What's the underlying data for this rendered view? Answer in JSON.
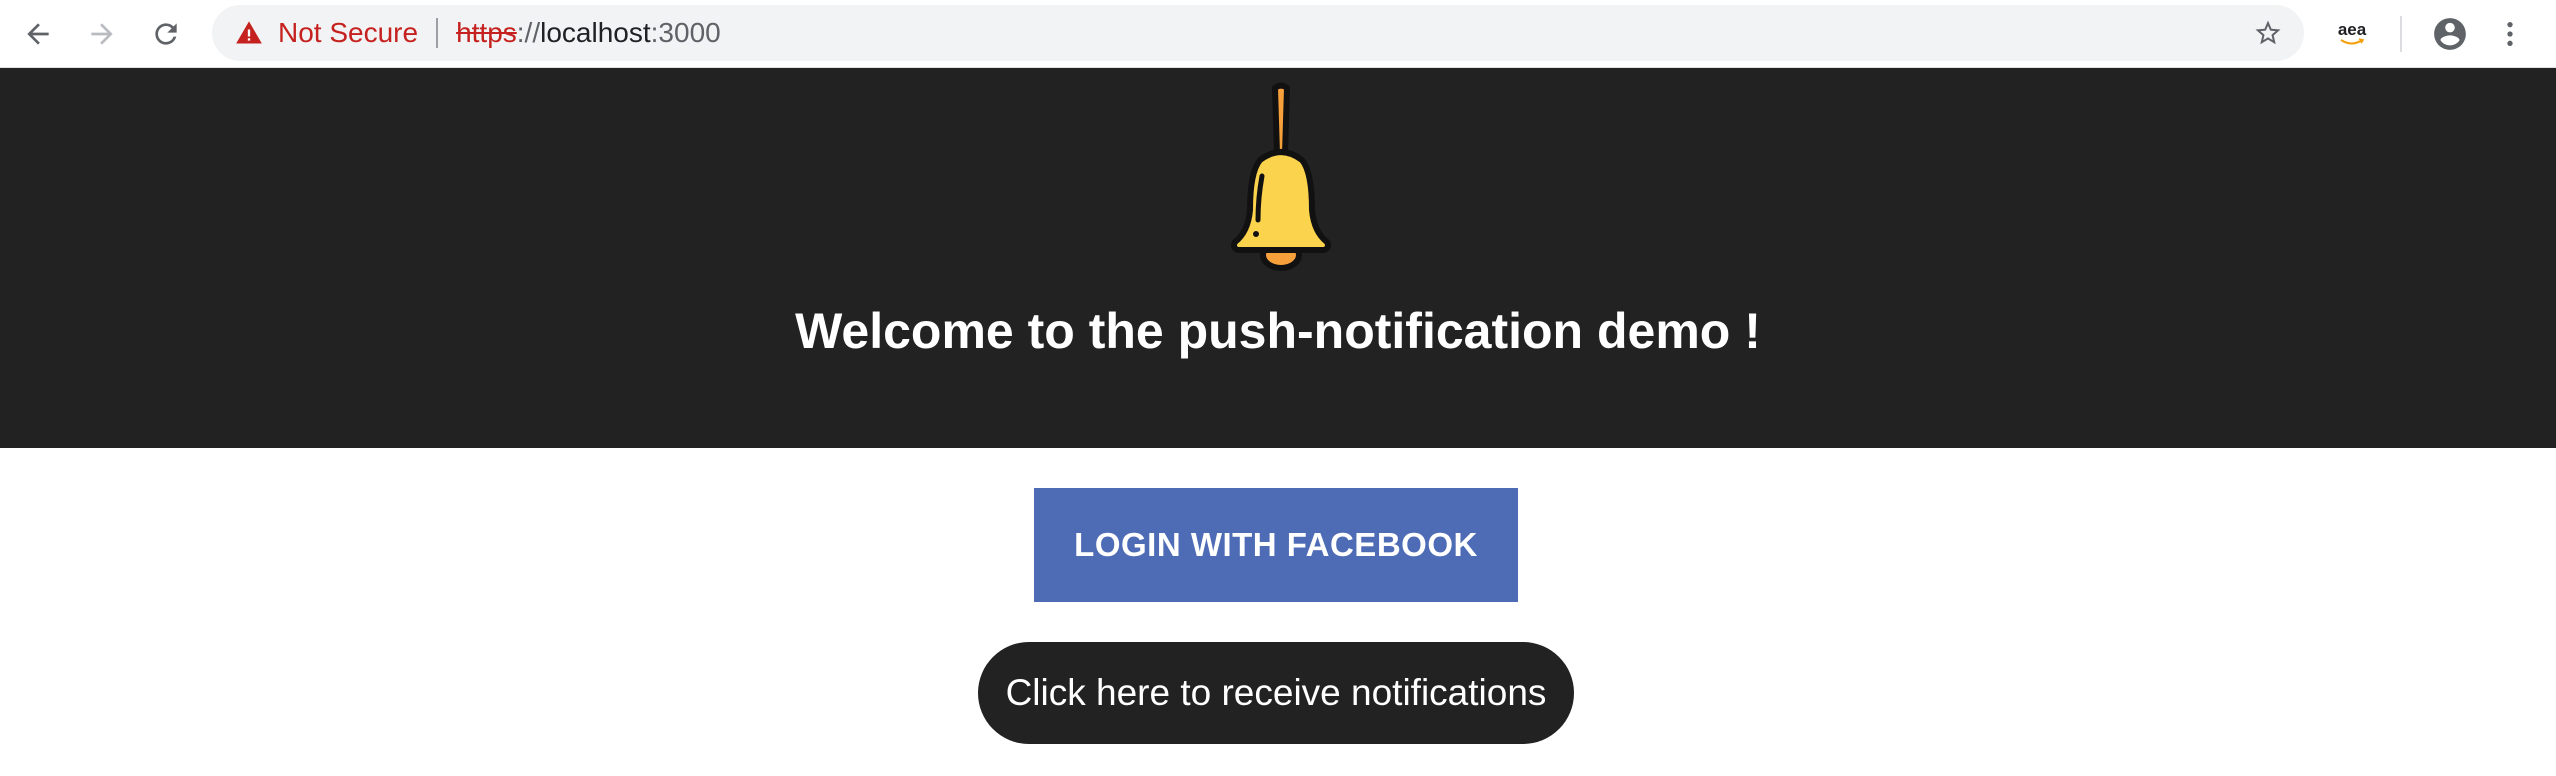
{
  "browser": {
    "security_label": "Not Secure",
    "url_scheme": "https",
    "url_separator": "://",
    "url_host": "localhost",
    "url_port": ":3000",
    "extension_label": "aea",
    "icons": {
      "back": "arrow-left-icon",
      "forward": "arrow-right-icon",
      "reload": "reload-icon",
      "warning": "warning-triangle-icon",
      "bookmark": "star-outline-icon",
      "extension": "amazon-assistant-icon",
      "profile": "account-circle-icon",
      "menu": "vertical-dots-icon"
    },
    "colors": {
      "warning": "#c5221f",
      "omnibox_bg": "#f1f3f4"
    }
  },
  "page": {
    "hero": {
      "icon": "bell-icon",
      "title": "Welcome to the push-notification demo !",
      "background": "#222222"
    },
    "facebook_button": {
      "label": "LOGIN WITH FACEBOOK",
      "color": "#4e6bb5"
    },
    "notifications_button": {
      "label": "Click here to receive notifications",
      "color": "#222222"
    },
    "colors": {
      "bell_body": "#fcd34d",
      "bell_handle": "#f6a03b"
    }
  }
}
